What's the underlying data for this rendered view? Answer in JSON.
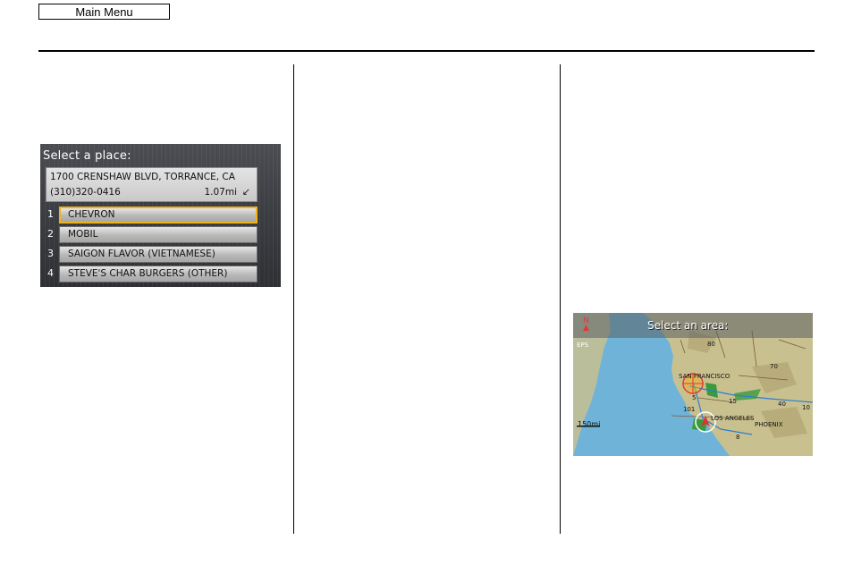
{
  "header": {
    "main_menu_label": "Main Menu"
  },
  "place_screen": {
    "title": "Select a place:",
    "address": "1700 CRENSHAW BLVD, TORRANCE, CA",
    "phone": "(310)320-0416",
    "distance": "1.07mi",
    "direction_icon": "arrow-southwest-icon",
    "items": [
      {
        "num": "1",
        "label": "CHEVRON",
        "selected": true
      },
      {
        "num": "2",
        "label": "MOBIL"
      },
      {
        "num": "3",
        "label": "SAIGON FLAVOR (VIETNAMESE)"
      },
      {
        "num": "4",
        "label": "STEVE'S CHAR BURGERS (OTHER)"
      }
    ],
    "accent_color": "#f0b21a"
  },
  "map_screen": {
    "title": "Select an area:",
    "cities": [
      "SAN FRANCISCO",
      "LOS ANGELES",
      "PHOENIX"
    ],
    "highways": [
      "80",
      "70",
      "5",
      "15",
      "40",
      "101",
      "8",
      "10"
    ],
    "scale": "150mi",
    "eps_label": "EPS",
    "colors": {
      "ocean": "#6fb3d8",
      "land": "#c9c08f",
      "parks": "#3b9a3d"
    }
  }
}
